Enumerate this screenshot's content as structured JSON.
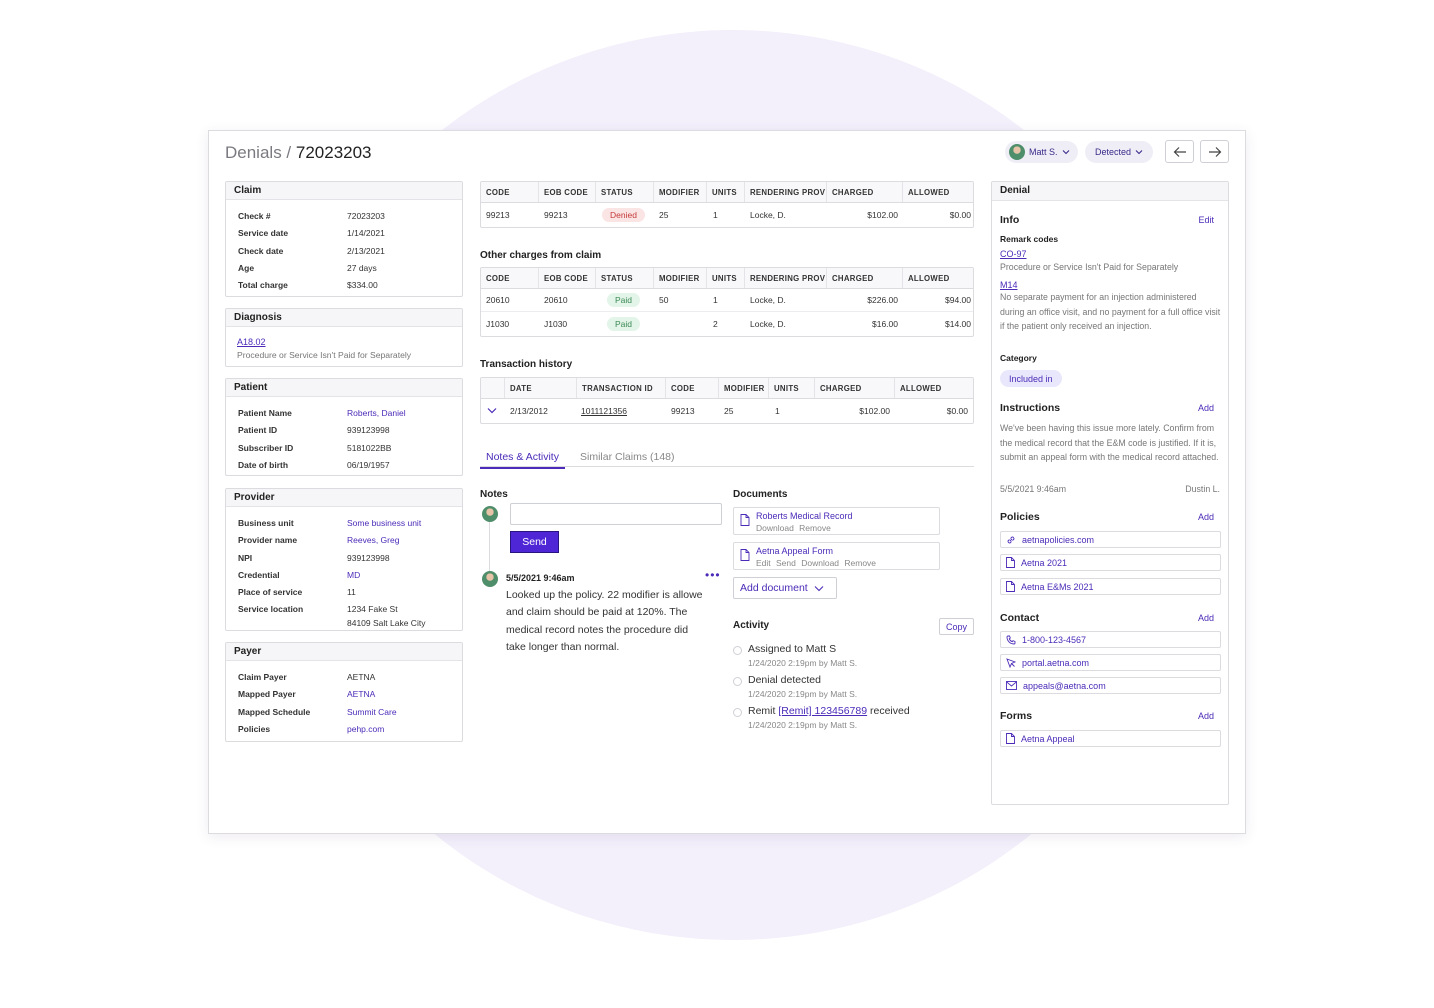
{
  "header": {
    "breadcrumb": "Denials /",
    "claim_id": "72023203",
    "user": "Matt S.",
    "status": "Detected"
  },
  "claim": {
    "title": "Claim",
    "rows": [
      {
        "k": "Check #",
        "v": "72023203"
      },
      {
        "k": "Service date",
        "v": "1/14/2021"
      },
      {
        "k": "Check date",
        "v": "2/13/2021"
      },
      {
        "k": "Age",
        "v": "27 days"
      },
      {
        "k": "Total charge",
        "v": "$334.00"
      }
    ]
  },
  "diagnosis": {
    "title": "Diagnosis",
    "code": "A18.02",
    "desc": "Procedure or Service Isn't Paid for Separately"
  },
  "patient": {
    "title": "Patient",
    "rows": [
      {
        "k": "Patient Name",
        "v": "Roberts, Daniel"
      },
      {
        "k": "Patient ID",
        "v": "939123998"
      },
      {
        "k": "Subscriber ID",
        "v": "5181022BB"
      },
      {
        "k": "Date of birth",
        "v": "06/19/1957"
      }
    ]
  },
  "provider": {
    "title": "Provider",
    "rows": [
      {
        "k": "Business unit",
        "v": "Some business unit"
      },
      {
        "k": "Provider name",
        "v": "Reeves, Greg"
      },
      {
        "k": "NPI",
        "v": "939123998"
      },
      {
        "k": "Credential",
        "v": "MD"
      },
      {
        "k": "Place of service",
        "v": "11"
      },
      {
        "k": "Service location",
        "v": "1234 Fake St",
        "v2": "84109 Salt Lake City"
      }
    ]
  },
  "payer": {
    "title": "Payer",
    "rows": [
      {
        "k": "Claim Payer",
        "v": "AETNA"
      },
      {
        "k": "Mapped Payer",
        "v": "AETNA"
      },
      {
        "k": "Mapped Schedule",
        "v": "Summit Care"
      },
      {
        "k": "Policies",
        "v": "pehp.com"
      }
    ]
  },
  "charge_table": {
    "headers": [
      "CODE",
      "EOB CODE",
      "STATUS",
      "MODIFIER",
      "UNITS",
      "RENDERING PROV",
      "CHARGED",
      "ALLOWED"
    ],
    "rows": [
      {
        "code": "99213",
        "eob": "99213",
        "status": "Denied",
        "modifier": "25",
        "units": "1",
        "prov": "Locke, D.",
        "charged": "$102.00",
        "allowed": "$0.00"
      }
    ]
  },
  "other_charges": {
    "title": "Other charges from claim",
    "headers": [
      "CODE",
      "EOB CODE",
      "STATUS",
      "MODIFIER",
      "UNITS",
      "RENDERING PROV",
      "CHARGED",
      "ALLOWED"
    ],
    "rows": [
      {
        "code": "20610",
        "eob": "20610",
        "status": "Paid",
        "modifier": "50",
        "units": "1",
        "prov": "Locke, D.",
        "charged": "$226.00",
        "allowed": "$94.00"
      },
      {
        "code": "J1030",
        "eob": "J1030",
        "status": "Paid",
        "modifier": "",
        "units": "2",
        "prov": "Locke, D.",
        "charged": "$16.00",
        "allowed": "$14.00"
      }
    ]
  },
  "transactions": {
    "title": "Transaction history",
    "headers": [
      "DATE",
      "TRANSACTION ID",
      "CODE",
      "MODIFIER",
      "UNITS",
      "CHARGED",
      "ALLOWED"
    ],
    "rows": [
      {
        "date": "2/13/2012",
        "tid": "1011121356",
        "code": "99213",
        "modifier": "25",
        "units": "1",
        "charged": "$102.00",
        "allowed": "$0.00"
      }
    ]
  },
  "tabs": [
    "Notes & Activity",
    "Similar Claims (148)"
  ],
  "notes": {
    "title": "Notes",
    "send": "Send",
    "entry_time": "5/5/2021 9:46am",
    "entry_text": "Looked up the policy. 22 modifier is allowe and claim should be paid at 120%. The medical record notes the procedure did take longer than normal."
  },
  "documents": {
    "title": "Documents",
    "items": [
      {
        "name": "Roberts Medical Record",
        "actions": "Download Remove"
      },
      {
        "name": "Aetna Appeal Form",
        "actions": "Edit Send Download Remove"
      }
    ],
    "add": "Add document"
  },
  "activity": {
    "title": "Activity",
    "copy": "Copy",
    "items": [
      {
        "text": "Assigned to Matt S",
        "meta": "1/24/2020 2:19pm by Matt S."
      },
      {
        "text": "Denial detected",
        "meta": "1/24/2020 2:19pm by Matt S."
      },
      {
        "pre": "Remit ",
        "link": "[Remit] 123456789",
        "post": " received",
        "meta": "1/24/2020 2:19pm by Matt S."
      }
    ]
  },
  "denial": {
    "title": "Denial",
    "info": "Info",
    "edit": "Edit",
    "remark_title": "Remark codes",
    "remarks": [
      {
        "code": "CO-97",
        "desc": "Procedure or Service Isn't Paid for Separately"
      },
      {
        "code": "M14",
        "desc": "No separate payment for an injection administered during an office visit, and no payment for a full office visit if the patient only received an injection."
      }
    ],
    "category_title": "Category",
    "category": "Included in",
    "instructions_title": "Instructions",
    "add": "Add",
    "instructions": "We've been having this issue more lately. Confirm from the medical record that the E&M code is justified. If it is, submit an appeal form with the medical record attached.",
    "instr_date": "5/5/2021 9:46am",
    "instr_author": "Dustin L.",
    "policies_title": "Policies",
    "policies": [
      "aetnapolicies.com",
      "Aetna 2021",
      "Aetna E&Ms 2021"
    ],
    "contact_title": "Contact",
    "contacts": [
      "1-800-123-4567",
      "portal.aetna.com",
      "appeals@aetna.com"
    ],
    "forms_title": "Forms",
    "forms": [
      "Aetna Appeal"
    ]
  },
  "colors": {
    "accent": "#4b2bb8",
    "button": "#4f26d6",
    "denied": "#c43a3a",
    "paid": "#3c8a55"
  }
}
